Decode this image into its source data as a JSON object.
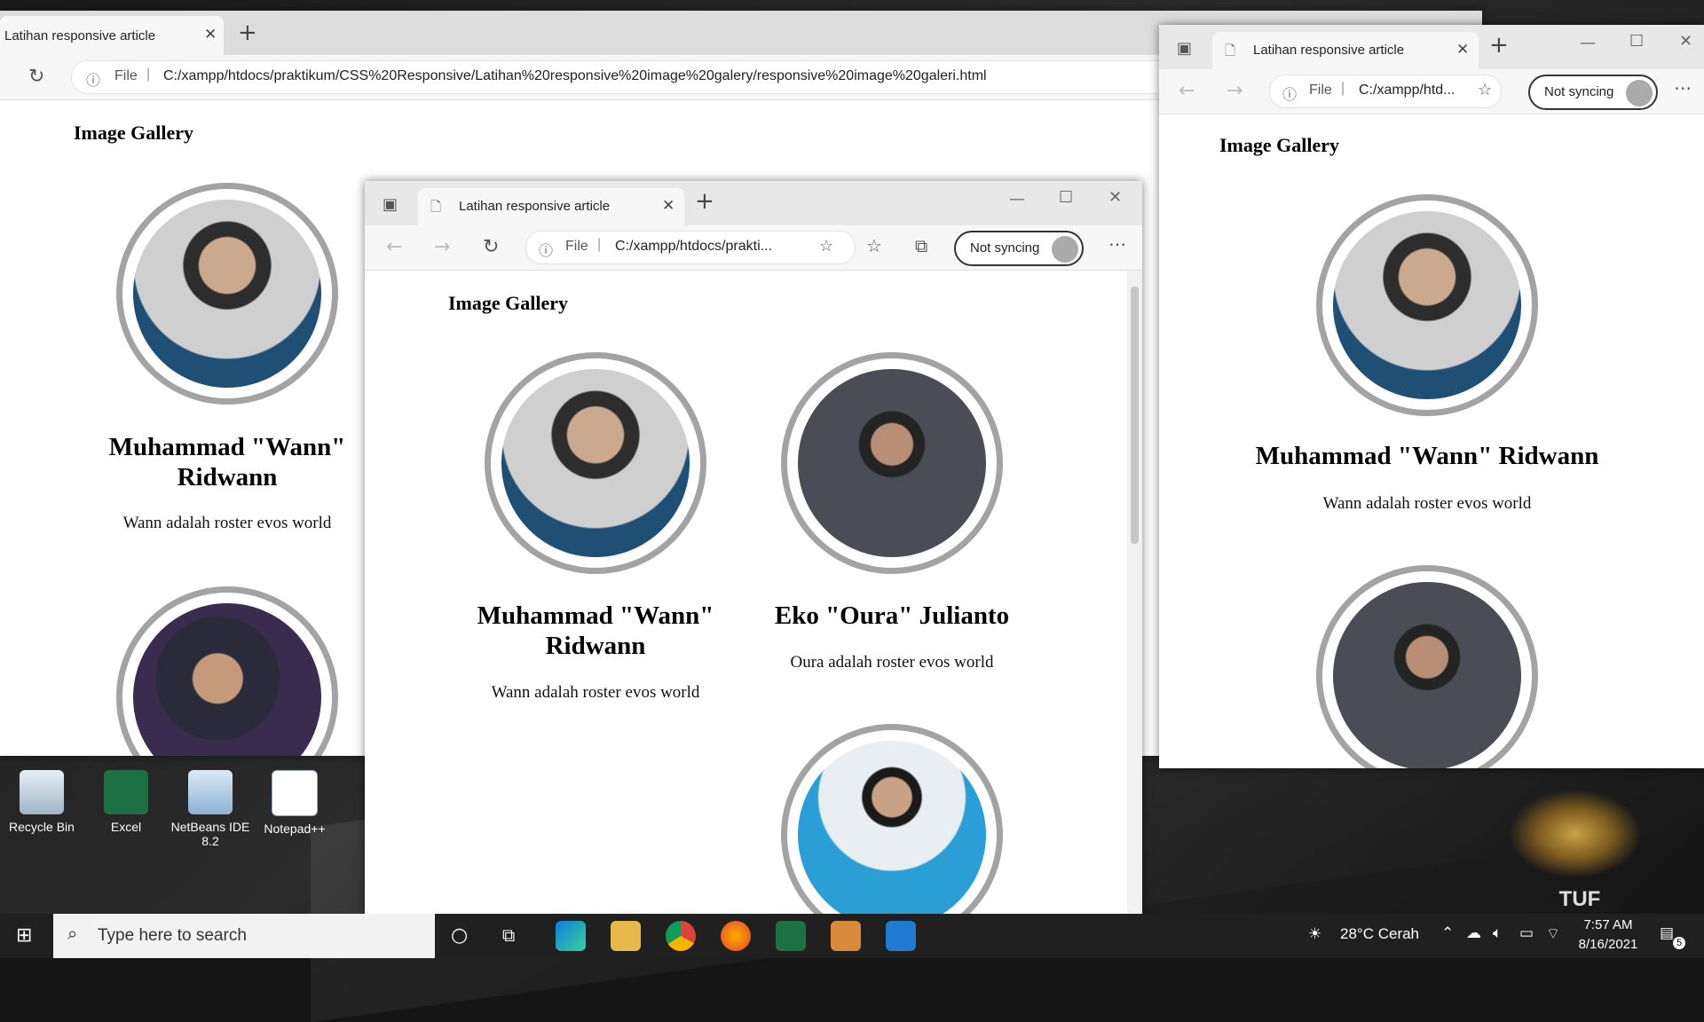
{
  "desktop": {
    "icons": [
      {
        "label": "Recycle Bin"
      },
      {
        "label": "Excel"
      },
      {
        "label": "NetBeans IDE 8.2"
      },
      {
        "label": "Notepad++"
      }
    ],
    "brand": "TUF GAMING"
  },
  "win_back": {
    "tab_title": "Latihan responsive article",
    "file_label": "File",
    "url": "C:/xampp/htdocs/praktikum/CSS%20Responsive/Latihan%20responsive%20image%20galery/responsive%20image%20galeri.html",
    "gallery_title": "Image Gallery",
    "card1_name": "Muhammad \"Wann\" Ridwann",
    "card1_desc": "Wann adalah roster evos world"
  },
  "win_middle": {
    "tab_title": "Latihan responsive article",
    "file_label": "File",
    "url": "C:/xampp/htdocs/prakti...",
    "sync_label": "Not syncing",
    "gallery_title": "Image Gallery",
    "card1_name": "Muhammad \"Wann\" Ridwann",
    "card1_desc": "Wann adalah roster evos world",
    "card2_name": "Eko \"Oura\" Julianto",
    "card2_desc": "Oura adalah roster evos world"
  },
  "win_right": {
    "tab_title": "Latihan responsive article",
    "file_label": "File",
    "url": "C:/xampp/htd...",
    "sync_label": "Not syncing",
    "gallery_title": "Image Gallery",
    "card1_name": "Muhammad \"Wann\" Ridwann",
    "card1_desc": "Wann adalah roster evos world"
  },
  "taskbar": {
    "search_placeholder": "Type here to search",
    "weather": "28°C  Cerah",
    "time": "7:57 AM",
    "date": "8/16/2021",
    "notification_count": "5"
  }
}
